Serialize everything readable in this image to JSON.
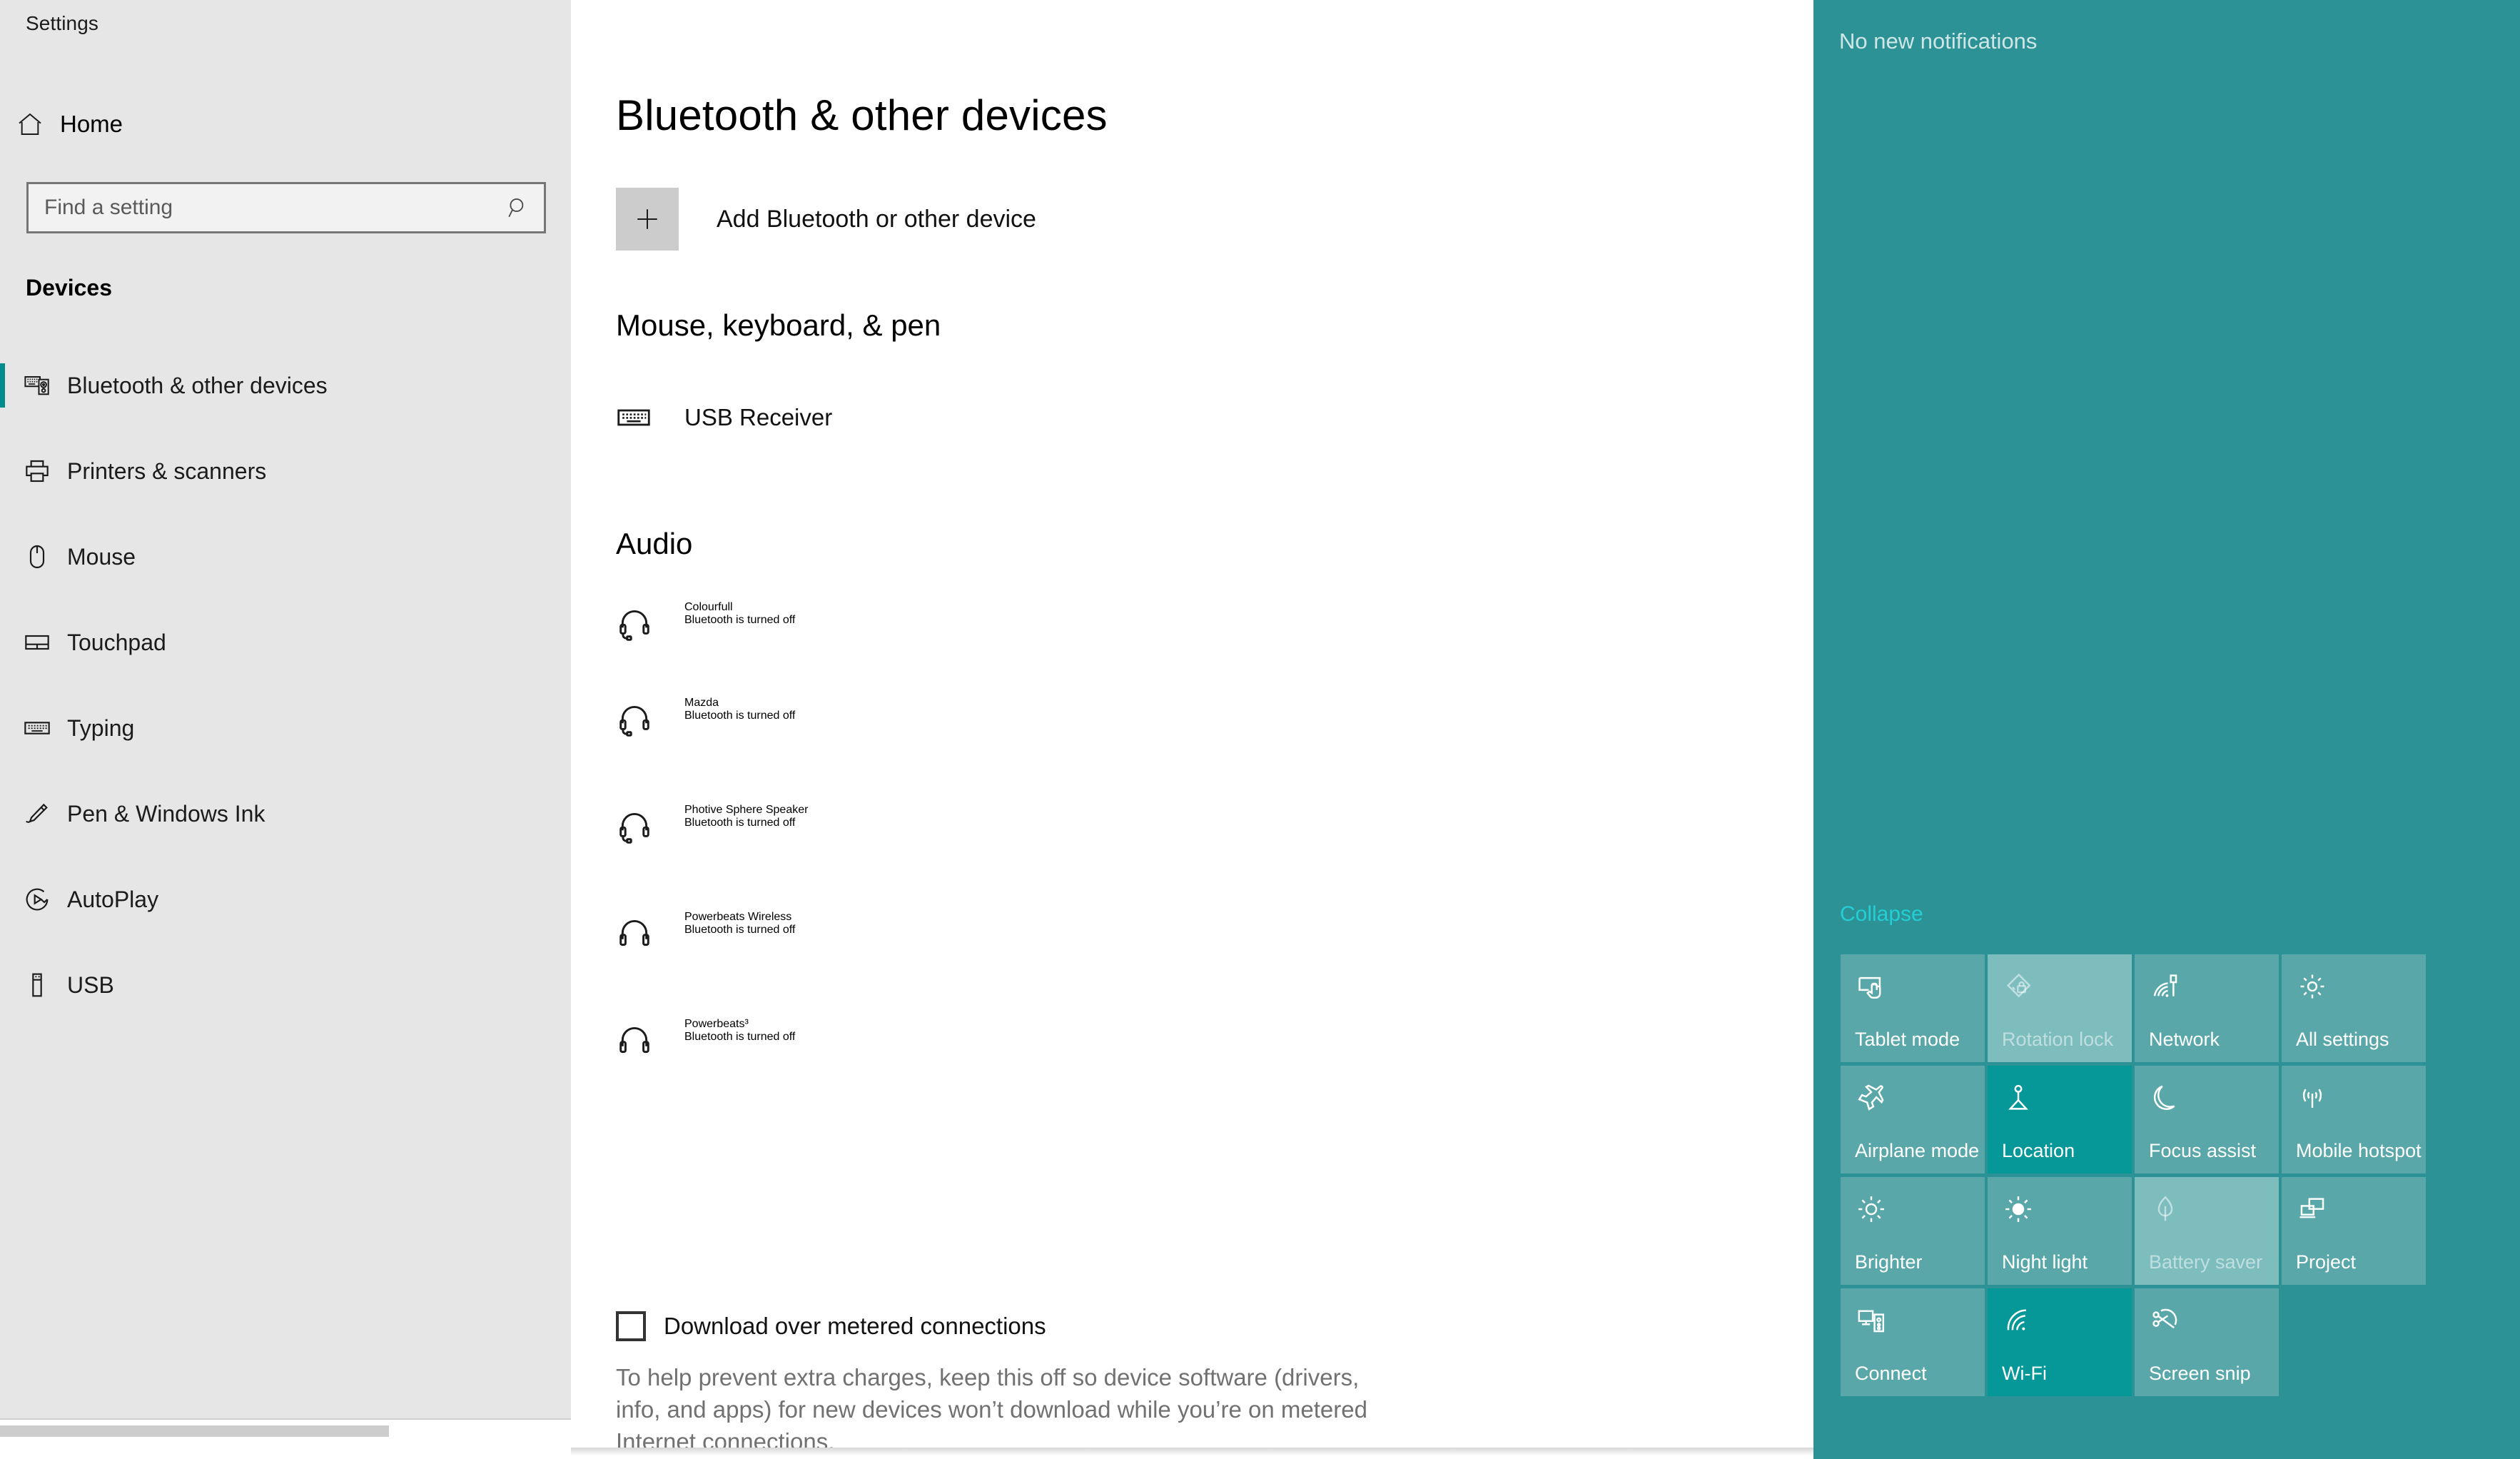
{
  "window": {
    "app_title": "Settings"
  },
  "sidebar": {
    "home_label": "Home",
    "home_icon": "home-icon",
    "search": {
      "placeholder": "Find a setting",
      "value": "",
      "icon": "search-icon"
    },
    "category_heading": "Devices",
    "accent_color": "#008c8c",
    "background_color": "#e6e6e6",
    "items": [
      {
        "label": "Bluetooth & other devices",
        "icon": "bluetooth-devices-icon",
        "selected": true
      },
      {
        "label": "Printers & scanners",
        "icon": "printer-icon",
        "selected": false
      },
      {
        "label": "Mouse",
        "icon": "mouse-icon",
        "selected": false
      },
      {
        "label": "Touchpad",
        "icon": "touchpad-icon",
        "selected": false
      },
      {
        "label": "Typing",
        "icon": "keyboard-icon",
        "selected": false
      },
      {
        "label": "Pen & Windows Ink",
        "icon": "pen-icon",
        "selected": false
      },
      {
        "label": "AutoPlay",
        "icon": "autoplay-icon",
        "selected": false
      },
      {
        "label": "USB",
        "icon": "usb-icon",
        "selected": false
      }
    ]
  },
  "main": {
    "page_title": "Bluetooth & other devices",
    "add_device": {
      "label": "Add Bluetooth or other device",
      "icon": "plus-icon"
    },
    "sections": [
      {
        "heading": "Mouse, keyboard, & pen",
        "devices": [
          {
            "name": "USB Receiver",
            "status": "",
            "icon": "keyboard-icon"
          }
        ]
      },
      {
        "heading": "Audio",
        "devices": [
          {
            "name": "Colourfull",
            "status": "Bluetooth is turned off",
            "icon": "headset-icon"
          },
          {
            "name": "Mazda",
            "status": "Bluetooth is turned off",
            "icon": "headset-icon"
          },
          {
            "name": "Photive Sphere Speaker",
            "status": "Bluetooth is turned off",
            "icon": "headset-icon"
          },
          {
            "name": "Powerbeats Wireless",
            "status": "Bluetooth is turned off",
            "icon": "headphones-icon"
          },
          {
            "name": "Powerbeats³",
            "status": "Bluetooth is turned off",
            "icon": "headphones-icon"
          }
        ]
      }
    ],
    "metered": {
      "checkbox_label": "Download over metered connections",
      "checked": false,
      "description": "To help prevent extra charges, keep this off so device software (drivers, info, and apps) for new devices won’t download while you’re on metered Internet connections."
    }
  },
  "action_center": {
    "notifications_empty_text": "No new notifications",
    "collapse_label": "Collapse",
    "background_color": "#2d9296",
    "tile_color": "#59a7a9",
    "tile_active_color": "#069799",
    "tile_disabled_color": "#7dbdbe",
    "link_color": "#23cfd4",
    "tiles": [
      {
        "label": "Tablet mode",
        "icon": "tablet-mode-icon",
        "state": "normal"
      },
      {
        "label": "Rotation lock",
        "icon": "rotation-lock-icon",
        "state": "disabled"
      },
      {
        "label": "Network",
        "icon": "network-icon",
        "state": "normal"
      },
      {
        "label": "All settings",
        "icon": "gear-icon",
        "state": "normal"
      },
      {
        "label": "Airplane mode",
        "icon": "airplane-icon",
        "state": "normal"
      },
      {
        "label": "Location",
        "icon": "location-icon",
        "state": "active"
      },
      {
        "label": "Focus assist",
        "icon": "moon-icon",
        "state": "normal"
      },
      {
        "label": "Mobile hotspot",
        "icon": "hotspot-icon",
        "state": "normal"
      },
      {
        "label": "Brighter",
        "icon": "brightness-icon",
        "state": "normal"
      },
      {
        "label": "Night light",
        "icon": "night-light-icon",
        "state": "normal"
      },
      {
        "label": "Battery saver",
        "icon": "leaf-icon",
        "state": "disabled"
      },
      {
        "label": "Project",
        "icon": "project-icon",
        "state": "normal"
      },
      {
        "label": "Connect",
        "icon": "connect-icon",
        "state": "normal"
      },
      {
        "label": "Wi-Fi",
        "icon": "wifi-icon",
        "state": "active"
      },
      {
        "label": "Screen snip",
        "icon": "snip-icon",
        "state": "normal"
      }
    ]
  }
}
